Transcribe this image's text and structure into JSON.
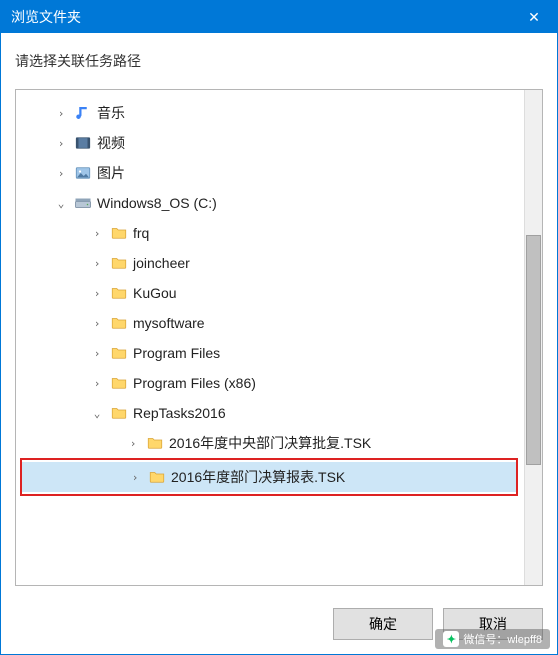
{
  "title": "浏览文件夹",
  "instruction": "请选择关联任务路径",
  "tree": {
    "items": [
      {
        "indent": 34,
        "expander": ">",
        "icon": "music",
        "label": "音乐"
      },
      {
        "indent": 34,
        "expander": ">",
        "icon": "video",
        "label": "视频"
      },
      {
        "indent": 34,
        "expander": ">",
        "icon": "image",
        "label": "图片"
      },
      {
        "indent": 34,
        "expander": "v",
        "icon": "drive",
        "label": "Windows8_OS (C:)"
      },
      {
        "indent": 70,
        "expander": ">",
        "icon": "folder",
        "label": "frq"
      },
      {
        "indent": 70,
        "expander": ">",
        "icon": "folder",
        "label": "joincheer"
      },
      {
        "indent": 70,
        "expander": ">",
        "icon": "folder",
        "label": "KuGou"
      },
      {
        "indent": 70,
        "expander": ">",
        "icon": "folder",
        "label": "mysoftware"
      },
      {
        "indent": 70,
        "expander": ">",
        "icon": "folder",
        "label": "Program Files"
      },
      {
        "indent": 70,
        "expander": ">",
        "icon": "folder",
        "label": "Program Files (x86)"
      },
      {
        "indent": 70,
        "expander": "v",
        "icon": "folder",
        "label": "RepTasks2016"
      },
      {
        "indent": 106,
        "expander": ">",
        "icon": "folder",
        "label": "2016年度中央部门决算批复.TSK"
      },
      {
        "indent": 106,
        "expander": ">",
        "icon": "folder",
        "label": "2016年度部门决算报表.TSK",
        "selected": true
      }
    ]
  },
  "buttons": {
    "ok": "确定",
    "cancel": "取消"
  },
  "watermark": "微信号：wlepff8"
}
